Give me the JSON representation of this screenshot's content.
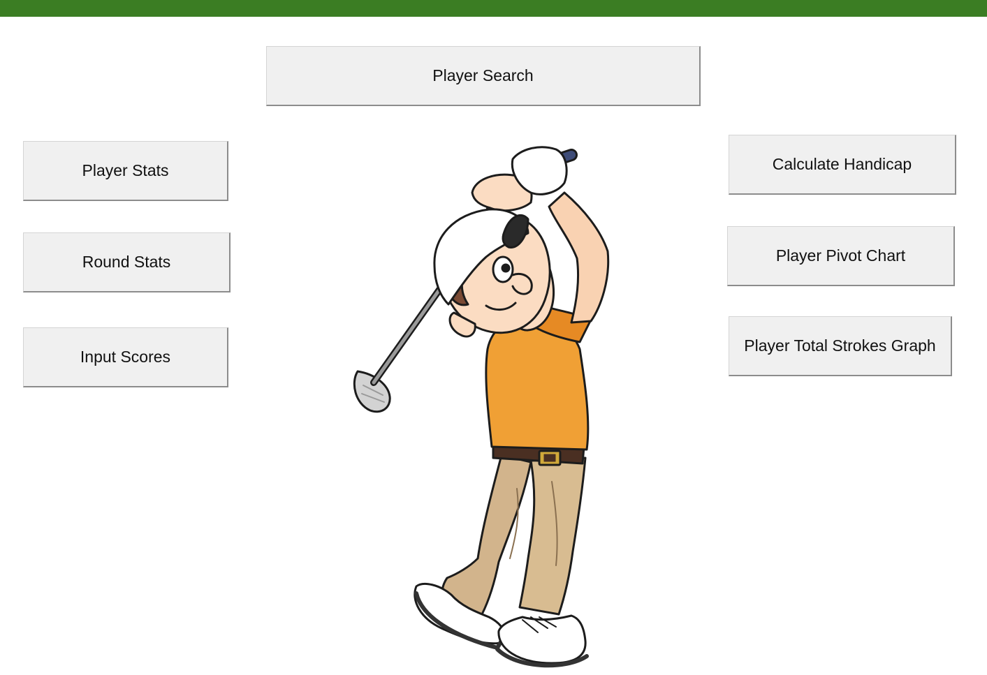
{
  "header": {
    "bar_color": "#3b7d23"
  },
  "buttons": {
    "player_search": "Player Search",
    "player_stats": "Player Stats",
    "round_stats": "Round Stats",
    "input_scores": "Input Scores",
    "calculate_handicap": "Calculate Handicap",
    "player_pivot_chart": "Player Pivot Chart",
    "player_total_strokes_graph": "Player Total Strokes Graph"
  },
  "illustration": {
    "icon": "golfer-illustration"
  }
}
